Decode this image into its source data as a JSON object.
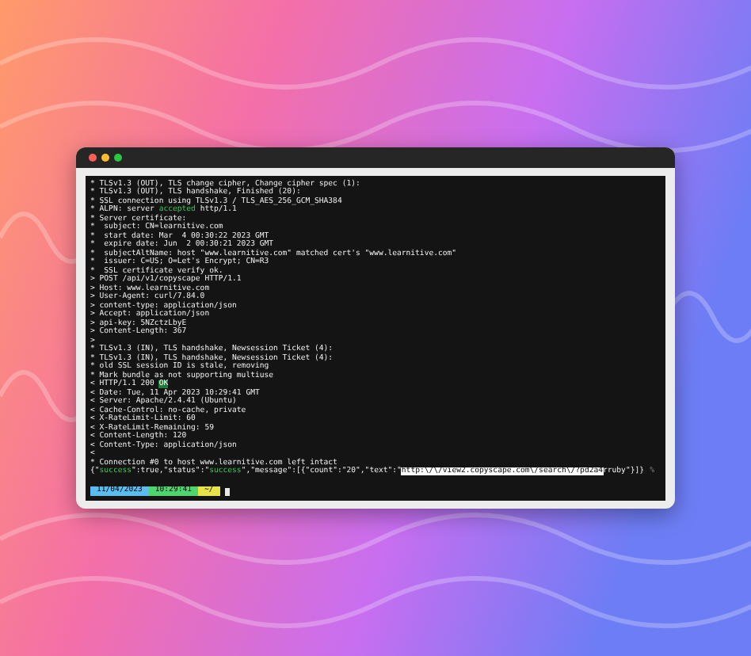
{
  "terminal": {
    "lines": [
      [
        {
          "kind": "plain",
          "text": "* TLSv1.3 (OUT), TLS change cipher, Change cipher spec (1):"
        }
      ],
      [
        {
          "kind": "plain",
          "text": "* TLSv1.3 (OUT), TLS handshake, Finished (20):"
        }
      ],
      [
        {
          "kind": "plain",
          "text": "* SSL connection using TLSv1.3 / TLS_AES_256_GCM_SHA384"
        }
      ],
      [
        {
          "kind": "plain",
          "text": "* ALPN: server "
        },
        {
          "kind": "green",
          "text": "accepted"
        },
        {
          "kind": "plain",
          "text": " http/1.1"
        }
      ],
      [
        {
          "kind": "plain",
          "text": "* Server certificate:"
        }
      ],
      [
        {
          "kind": "plain",
          "text": "*  subject: CN=learnitive.com"
        }
      ],
      [
        {
          "kind": "plain",
          "text": "*  start date: Mar  4 00:30:22 2023 GMT"
        }
      ],
      [
        {
          "kind": "plain",
          "text": "*  expire date: Jun  2 00:30:21 2023 GMT"
        }
      ],
      [
        {
          "kind": "plain",
          "text": "*  subjectAltName: host \"www.learnitive.com\" matched cert's \"www.learnitive.com\""
        }
      ],
      [
        {
          "kind": "plain",
          "text": "*  issuer: C=US; O=Let's Encrypt; CN=R3"
        }
      ],
      [
        {
          "kind": "plain",
          "text": "*  SSL certificate verify ok."
        }
      ],
      [
        {
          "kind": "plain",
          "text": "> POST /api/v1/copyscape HTTP/1.1"
        }
      ],
      [
        {
          "kind": "plain",
          "text": "> Host: www.learnitive.com"
        }
      ],
      [
        {
          "kind": "plain",
          "text": "> User-Agent: curl/7.84.0"
        }
      ],
      [
        {
          "kind": "plain",
          "text": "> content-type: application/json"
        }
      ],
      [
        {
          "kind": "plain",
          "text": "> Accept: application/json"
        }
      ],
      [
        {
          "kind": "plain",
          "text": "> api-key: 5NZctzLbyE"
        }
      ],
      [
        {
          "kind": "plain",
          "text": "> Content-Length: 367"
        }
      ],
      [
        {
          "kind": "plain",
          "text": ">"
        }
      ],
      [
        {
          "kind": "plain",
          "text": "* TLSv1.3 (IN), TLS handshake, Newsession Ticket (4):"
        }
      ],
      [
        {
          "kind": "plain",
          "text": "* TLSv1.3 (IN), TLS handshake, Newsession Ticket (4):"
        }
      ],
      [
        {
          "kind": "plain",
          "text": "* old SSL session ID is stale, removing"
        }
      ],
      [
        {
          "kind": "plain",
          "text": "* Mark bundle as not supporting multiuse"
        }
      ],
      [
        {
          "kind": "plain",
          "text": "< HTTP/1.1 200 "
        },
        {
          "kind": "badge",
          "text": "OK"
        }
      ],
      [
        {
          "kind": "plain",
          "text": "< Date: Tue, 11 Apr 2023 10:29:41 GMT"
        }
      ],
      [
        {
          "kind": "plain",
          "text": "< Server: Apache/2.4.41 (Ubuntu)"
        }
      ],
      [
        {
          "kind": "plain",
          "text": "< Cache-Control: no-cache, private"
        }
      ],
      [
        {
          "kind": "plain",
          "text": "< X-RateLimit-Limit: 60"
        }
      ],
      [
        {
          "kind": "plain",
          "text": "< X-RateLimit-Remaining: 59"
        }
      ],
      [
        {
          "kind": "plain",
          "text": "< Content-Length: 120"
        }
      ],
      [
        {
          "kind": "plain",
          "text": "< Content-Type: application/json"
        }
      ],
      [
        {
          "kind": "plain",
          "text": "<"
        }
      ],
      [
        {
          "kind": "plain",
          "text": "* Connection #0 to host www.learnitive.com left intact"
        }
      ],
      [
        {
          "kind": "plain",
          "text": "{\""
        },
        {
          "kind": "green",
          "text": "success"
        },
        {
          "kind": "plain",
          "text": "\":true,\"status\":\""
        },
        {
          "kind": "green",
          "text": "success"
        },
        {
          "kind": "plain",
          "text": "\",\"message\":[{\"count\":\"20\",\"text\":\""
        },
        {
          "kind": "selected",
          "text": "http:\\/\\/view2.copyscape.com\\/search\\/?pd2a4"
        },
        {
          "kind": "plain",
          "text": "rruby\"}]}"
        }
      ]
    ],
    "end_mark": "%",
    "prompt": [
      {
        "text": "11/04/2023",
        "color": "#5bbcf0"
      },
      {
        "text": "10:29:41",
        "color": "#4fd46e"
      },
      {
        "text": "~/",
        "color": "#e8e24a"
      }
    ]
  }
}
